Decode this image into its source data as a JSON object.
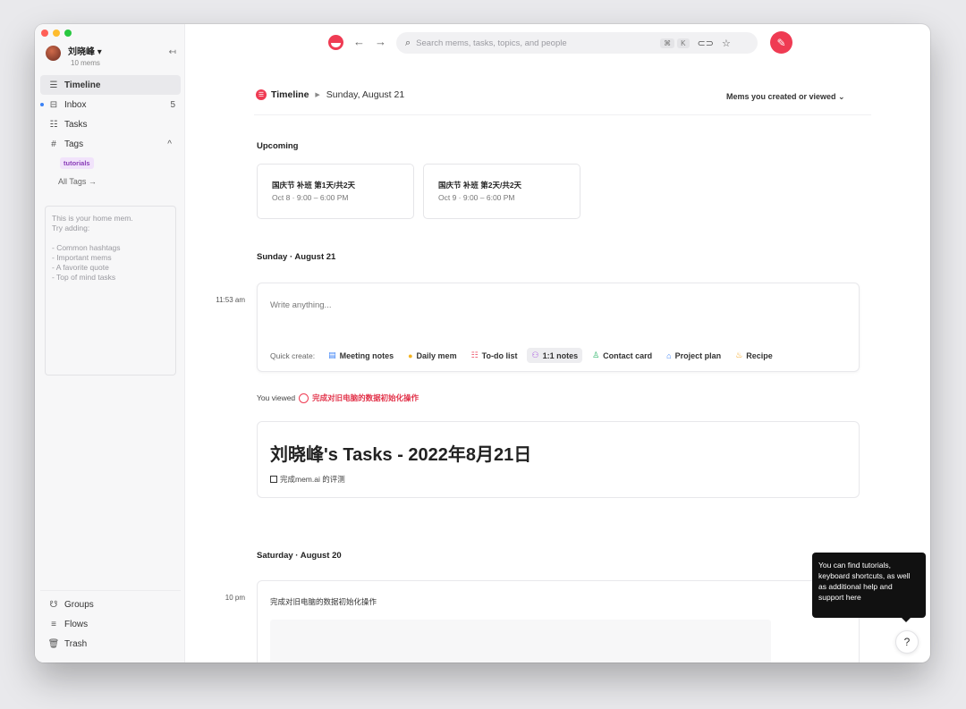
{
  "sidebar": {
    "user_name": "刘晓峰 ▾",
    "mem_count": "10 mems",
    "collapse_glyph": "↤",
    "items": [
      {
        "label": "Timeline",
        "icon": "☰"
      },
      {
        "label": "Inbox",
        "icon": "⊟",
        "count": "5"
      },
      {
        "label": "Tasks",
        "icon": "☷"
      },
      {
        "label": "Tags",
        "icon": "#",
        "chevron": "^"
      }
    ],
    "tag_pill": "tutorials",
    "all_tags": "All Tags →",
    "home_note": "This is your home mem.\nTry adding:\n\n- Common hashtags\n- Important mems\n- A favorite quote\n- Top of mind tasks",
    "bottom": [
      {
        "label": "Groups",
        "icon": "☋"
      },
      {
        "label": "Flows",
        "icon": "≡"
      },
      {
        "label": "Trash",
        "icon": "🗑"
      }
    ]
  },
  "toolbar": {
    "back": "←",
    "forward": "→",
    "search_icon": "⌕",
    "search_placeholder": "Search mems, tasks, topics, and people",
    "kbd1": "⌘",
    "kbd2": "K",
    "link_icon": "⊂⊃",
    "star_icon": "☆",
    "compose_icon": "✎"
  },
  "header": {
    "title": "Timeline",
    "sep": "▶",
    "date": "Sunday, August 21",
    "filter": "Mems you created or viewed ⌄"
  },
  "upcoming": {
    "heading": "Upcoming",
    "events": [
      {
        "title": "国庆节 补班 第1天/共2天",
        "time": "Oct 8 · 9:00 – 6:00 PM"
      },
      {
        "title": "国庆节 补班 第2天/共2天",
        "time": "Oct 9 · 9:00 – 6:00 PM"
      }
    ]
  },
  "sunday": {
    "heading": "Sunday · August 21",
    "time": "11:53 am",
    "write_placeholder": "Write anything...",
    "quick_create_label": "Quick create:",
    "quick_items": [
      {
        "label": "Meeting notes",
        "icon": "▤",
        "color": "#3b82f6"
      },
      {
        "label": "Daily mem",
        "icon": "●",
        "color": "#f4b321"
      },
      {
        "label": "To-do list",
        "icon": "☷",
        "color": "#ef5a6f"
      },
      {
        "label": "1:1 notes",
        "icon": "⚇",
        "color": "#b066e0"
      },
      {
        "label": "Contact card",
        "icon": "♙",
        "color": "#2fb56a"
      },
      {
        "label": "Project plan",
        "icon": "⌂",
        "color": "#3b82f6"
      },
      {
        "label": "Recipe",
        "icon": "♨",
        "color": "#f59e0b"
      }
    ],
    "viewed_prefix": "You viewed",
    "viewed_link": "完成对旧电脑的数据初始化操作",
    "card_title": "刘晓峰's Tasks - 2022年8月21日",
    "card_task": "完成mem.ai 的评测"
  },
  "saturday": {
    "heading": "Saturday · August 20",
    "time": "10 pm",
    "entry_text": "完成对旧电脑的数据初始化操作"
  },
  "tooltip": "You can find tutorials, keyboard shortcuts, as well as additional help and support here",
  "help_glyph": "?",
  "colors": {
    "accent": "#ef3b53",
    "tag_bg": "#f1e3fb",
    "tag_fg": "#8a3db8"
  }
}
